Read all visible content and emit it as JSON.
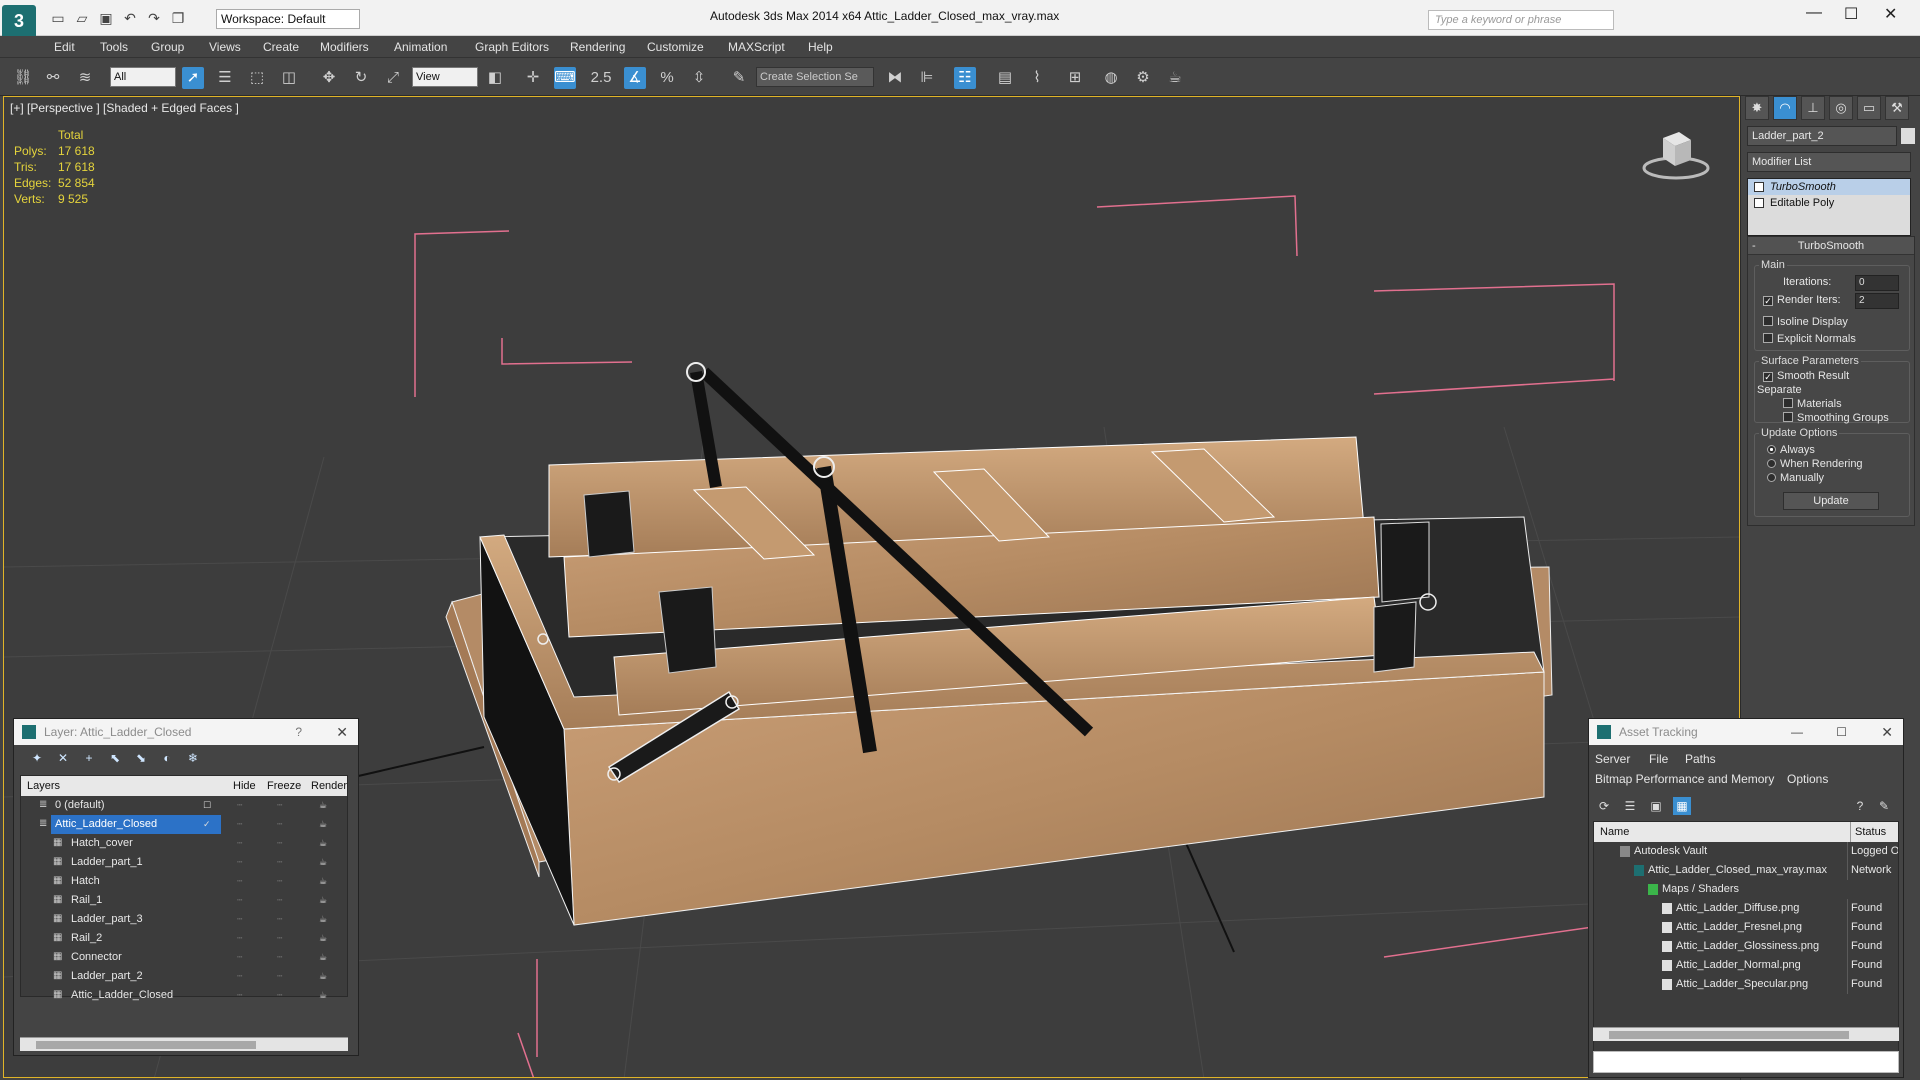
{
  "app": {
    "workspace": "Workspace: Default",
    "title": "Autodesk 3ds Max  2014 x64     Attic_Ladder_Closed_max_vray.max",
    "search_placeholder": "Type a keyword or phrase"
  },
  "menu": [
    "Edit",
    "Tools",
    "Group",
    "Views",
    "Create",
    "Modifiers",
    "Animation",
    "Graph Editors",
    "Rendering",
    "Customize",
    "MAXScript",
    "Help"
  ],
  "toolbar": {
    "selection_filter": "All",
    "ref_coord": "View",
    "named_selection_placeholder": "Create Selection Se",
    "snap_angle_label": "2.5"
  },
  "viewport": {
    "label": "[+] [Perspective ] [Shaded + Edged Faces ]",
    "stats_header": "Total",
    "stats": [
      {
        "key": "Polys:",
        "value": "17 618"
      },
      {
        "key": "Tris:",
        "value": "17 618"
      },
      {
        "key": "Edges:",
        "value": "52 854"
      },
      {
        "key": "Verts:",
        "value": "9 525"
      }
    ]
  },
  "command_panel": {
    "object_name": "Ladder_part_2",
    "modifier_list": "Modifier List",
    "stack": [
      "TurboSmooth",
      "Editable Poly"
    ],
    "rollout_title": "TurboSmooth",
    "main_group": "Main",
    "iterations_label": "Iterations:",
    "iterations_value": "0",
    "render_iters_label": "Render Iters:",
    "render_iters_value": "2",
    "isoline": "Isoline Display",
    "explicit_normals": "Explicit Normals",
    "surface_params": "Surface Parameters",
    "smooth_result": "Smooth Result",
    "separate": "Separate",
    "materials": "Materials",
    "smoothing_groups": "Smoothing Groups",
    "update_options": "Update Options",
    "always": "Always",
    "when_rendering": "When Rendering",
    "manually": "Manually",
    "update_button": "Update"
  },
  "layer_manager": {
    "title": "Layer: Attic_Ladder_Closed",
    "help": "?",
    "columns": {
      "layers": "Layers",
      "hide": "Hide",
      "freeze": "Freeze",
      "render": "Render"
    },
    "rows": [
      {
        "name": "0 (default)",
        "level": 0
      },
      {
        "name": "Attic_Ladder_Closed",
        "level": 0
      },
      {
        "name": "Hatch_cover",
        "level": 1
      },
      {
        "name": "Ladder_part_1",
        "level": 1
      },
      {
        "name": "Hatch",
        "level": 1
      },
      {
        "name": "Rail_1",
        "level": 1
      },
      {
        "name": "Ladder_part_3",
        "level": 1
      },
      {
        "name": "Rail_2",
        "level": 1
      },
      {
        "name": "Connector",
        "level": 1
      },
      {
        "name": "Ladder_part_2",
        "level": 1
      },
      {
        "name": "Attic_Ladder_Closed",
        "level": 1
      }
    ]
  },
  "asset_tracking": {
    "title": "Asset Tracking",
    "menu1": [
      "Server",
      "File",
      "Paths"
    ],
    "menu2": [
      "Bitmap Performance and Memory",
      "Options"
    ],
    "columns": {
      "name": "Name",
      "status": "Status"
    },
    "rows": [
      {
        "name": "Autodesk Vault",
        "status": "Logged Out",
        "indent": 1
      },
      {
        "name": "Attic_Ladder_Closed_max_vray.max",
        "status": "Network",
        "indent": 2
      },
      {
        "name": "Maps / Shaders",
        "status": "",
        "indent": 3
      },
      {
        "name": "Attic_Ladder_Diffuse.png",
        "status": "Found",
        "indent": 4
      },
      {
        "name": "Attic_Ladder_Fresnel.png",
        "status": "Found",
        "indent": 4
      },
      {
        "name": "Attic_Ladder_Glossiness.png",
        "status": "Found",
        "indent": 4
      },
      {
        "name": "Attic_Ladder_Normal.png",
        "status": "Found",
        "indent": 4
      },
      {
        "name": "Attic_Ladder_Specular.png",
        "status": "Found",
        "indent": 4
      }
    ]
  }
}
